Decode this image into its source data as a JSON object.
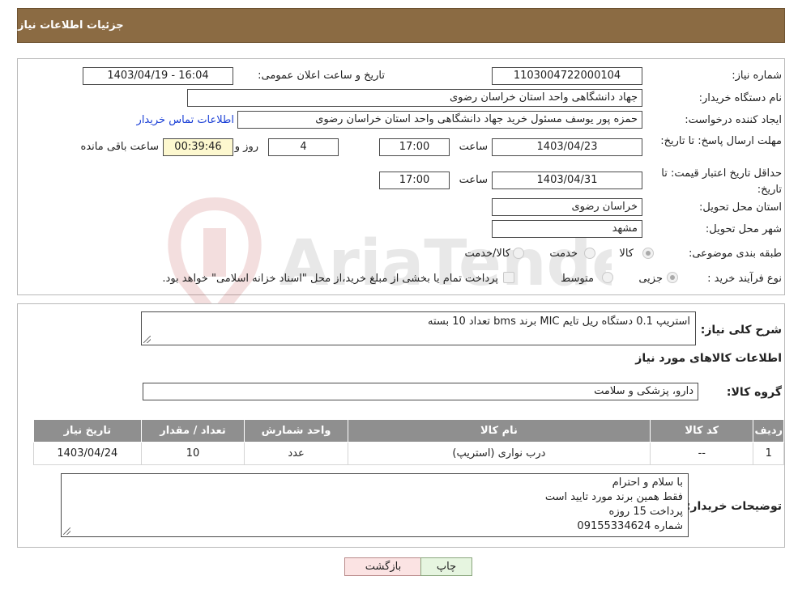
{
  "header": {
    "title": "جزئیات اطلاعات نیاز"
  },
  "form": {
    "need_number_label": "شماره نیاز:",
    "need_number": "1103004722000104",
    "announce_label": "تاریخ و ساعت اعلان عمومی:",
    "announce_value": "1403/04/19 - 16:04",
    "buyer_org_label": "نام دستگاه خریدار:",
    "buyer_org": "جهاد دانشگاهی واحد استان خراسان رضوی",
    "requester_label": "ایجاد کننده درخواست:",
    "requester": "حمزه  پور یوسف مسئول خرید جهاد دانشگاهی واحد استان خراسان رضوی",
    "contact_link": "اطلاعات تماس خریدار",
    "deadline_label": "مهلت ارسال پاسخ: تا تاریخ:",
    "deadline_date": "1403/04/23",
    "time_label": "ساعت",
    "deadline_time": "17:00",
    "days_remaining": "4",
    "days_label": "روز و",
    "time_remaining": "00:39:46",
    "remaining_label": "ساعت باقی مانده",
    "validity_label": "حداقل تاریخ اعتبار قیمت: تا تاریخ:",
    "validity_date": "1403/04/31",
    "validity_time": "17:00",
    "province_label": "استان محل تحویل:",
    "province": "خراسان رضوی",
    "city_label": "شهر محل تحویل:",
    "city": "مشهد",
    "category_label": "طبقه بندی موضوعی:",
    "category_options": [
      "کالا",
      "خدمت",
      "کالا/خدمت"
    ],
    "process_label": "نوع فرآیند خرید :",
    "process_options": [
      "جزیی",
      "متوسط"
    ],
    "process_note": "پرداخت تمام یا بخشی از مبلغ خرید،از محل \"اسناد خزانه اسلامی\" خواهد بود."
  },
  "details": {
    "desc_label": "شرح کلی نیاز:",
    "desc_value": "استریپ 0.1 دستگاه ریل تایم MIC برند bms تعداد 10 بسته",
    "goods_info_title": "اطلاعات کالاهای مورد نیاز",
    "group_label": "گروه کالا:",
    "group_value": "دارو، پزشکی و سلامت",
    "table": {
      "headers": [
        "ردیف",
        "کد کالا",
        "نام کالا",
        "واحد شمارش",
        "تعداد / مقدار",
        "تاریخ نیاز"
      ],
      "rows": [
        [
          "1",
          "--",
          "درب نواری (استریپ)",
          "عدد",
          "10",
          "1403/04/24"
        ]
      ]
    },
    "buyer_notes_label": "توضیحات خریدار:",
    "buyer_notes": [
      "با سلام و احترام",
      "فقط همین برند مورد تایید است",
      "پرداخت 15 روزه",
      "شماره 09155334624"
    ]
  },
  "buttons": {
    "print": "چاپ",
    "back": "بازگشت"
  },
  "watermark": {
    "text": "AriaTender.neT"
  },
  "colors": {
    "header": "#8b6b43",
    "link": "#1a3fd6",
    "table_header": "#8f8f8f",
    "back_button": "#fbe3e3",
    "print_button": "#e6f5e0"
  }
}
